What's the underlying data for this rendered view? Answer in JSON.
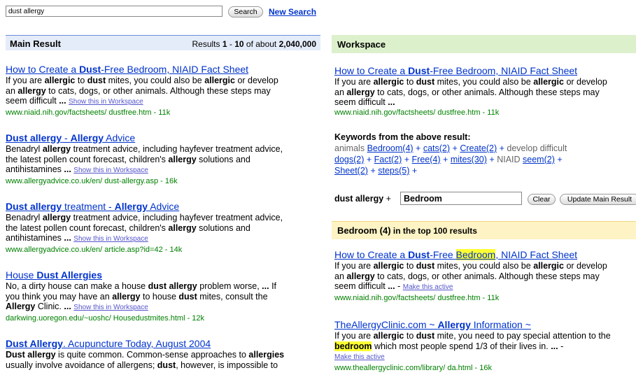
{
  "search": {
    "value": "dust allergy",
    "button": "Search",
    "new_search": "New Search"
  },
  "main": {
    "title": "Main Result",
    "count_prefix": "Results ",
    "count_from": "1",
    "count_sep": " - ",
    "count_to": "10",
    "count_mid": " of about ",
    "count_total": "2,040,000",
    "results": [
      {
        "title_a": "How to Create a ",
        "title_b": "Dust",
        "title_c": "-Free Bedroom, NIAID Fact Sheet",
        "snip1_a": "If you are ",
        "snip1_b": "allergic",
        "snip1_c": " to ",
        "snip1_d": "dust",
        "snip1_e": " mites, you could also be ",
        "snip1_f": "allergic",
        "snip1_g": " or develop",
        "snip2_a": "an ",
        "snip2_b": "allergy",
        "snip2_c": " to cats, dogs, or other animals. Although these steps may",
        "snip3_a": "seem difficult ",
        "snip3_b": "...",
        "show": "Show this in Workspace",
        "url": "www.niaid.nih.gov/factsheets/ dustfree.htm - 11k"
      },
      {
        "title_a": "Dust allergy",
        "title_b": " - ",
        "title_c": "Allergy",
        "title_d": " Advice",
        "snip1": "Benadryl ",
        "snip1_b": "allergy",
        "snip1_c": " treatment advice, including hayfever treatment advice,",
        "snip2": "the latest pollen count forecast, children's ",
        "snip2_b": "allergy",
        "snip2_c": " solutions and",
        "snip3": "antihistamines ",
        "snip3_b": "...",
        "show": "Show this in Workspace",
        "url": "www.allergyadvice.co.uk/en/ dust-allergy.asp - 16k"
      },
      {
        "title_a": "Dust allergy",
        "title_b": " treatment - ",
        "title_c": "Allergy",
        "title_d": " Advice",
        "snip1": "Benadryl ",
        "snip1_b": "allergy",
        "snip1_c": " treatment advice, including hayfever treatment advice,",
        "snip2": "the latest pollen count forecast, children's ",
        "snip2_b": "allergy",
        "snip2_c": " solutions and",
        "snip3": "antihistamines ",
        "snip3_b": "...",
        "show": "Show this in Workspace",
        "url": "www.allergyadvice.co.uk/en/ article.asp?id=42 - 14k"
      },
      {
        "title_a": "House ",
        "title_b": "Dust Allergies",
        "snip1_a": "No, a dirty house can make a house ",
        "snip1_b": "dust allergy",
        "snip1_c": " problem worse, ",
        "snip1_d": "...",
        "snip1_e": " If",
        "snip2_a": "you think you may have an ",
        "snip2_b": "allergy",
        "snip2_c": " to house ",
        "snip2_d": "dust",
        "snip2_e": " mites, consult the",
        "snip3_a": "Allergy",
        "snip3_b": " Clinic. ",
        "snip3_c": "...",
        "show": "Show this in Workspace",
        "url": "darkwing.uoregon.edu/~uoshc/ Housedustmites.html - 12k"
      },
      {
        "title_a": "Dust Allergy",
        "title_b": ". Acupuncture Today, August 2004",
        "snip1_a": "Dust allergy",
        "snip1_b": " is quite common. Common-sense approaches to ",
        "snip1_c": "allergies",
        "snip2_a": "usually involve avoidance of allergens; ",
        "snip2_b": "dust",
        "snip2_c": ", however, is impossible to"
      }
    ]
  },
  "workspace": {
    "title": "Workspace",
    "result": {
      "title_a": "How to Create a ",
      "title_b": "Dust",
      "title_c": "-Free Bedroom, NIAID Fact Sheet",
      "snip1_a": "If you are ",
      "snip1_b": "allergic",
      "snip1_c": " to ",
      "snip1_d": "dust",
      "snip1_e": " mites, you could also be ",
      "snip1_f": "allergic",
      "snip1_g": " or develop",
      "snip2_a": "an ",
      "snip2_b": "allergy",
      "snip2_c": " to cats, dogs, or other animals. Although these steps may",
      "snip3_a": "seem difficult ",
      "snip3_b": "...",
      "url": "www.niaid.nih.gov/factsheets/ dustfree.htm - 11k"
    },
    "keywords_title": "Keywords from the above result:",
    "keywords": {
      "animals": "animals",
      "bedroom": "Bedroom(4)",
      "cats": "cats(2)",
      "create": "Create(2)",
      "develop": "develop",
      "difficult": "difficult",
      "dogs": "dogs(2)",
      "fact": "Fact(2)",
      "free": "Free(4)",
      "mites": "mites(30)",
      "niaid": "NIAID",
      "seem": "seem(2)",
      "sheet": "Sheet(2)",
      "steps": "steps(5)",
      "plus": "+"
    },
    "refine": {
      "label_a": "dust allergy",
      "label_b": " + ",
      "value": "Bedroom",
      "clear": "Clear",
      "update": "Update Main Result"
    },
    "bedroom": {
      "title": "Bedroom (4)",
      "suffix": " in the top 100 results",
      "results": [
        {
          "title_a": "How to Create a ",
          "title_b": "Dust",
          "title_c": "-Free ",
          "title_hl": "Bedroom",
          "title_d": ", NIAID Fact Sheet",
          "snip1_a": "If you are ",
          "snip1_b": "allergic",
          "snip1_c": " to ",
          "snip1_d": "dust",
          "snip1_e": " mites, you could also be ",
          "snip1_f": "allergic",
          "snip1_g": " or develop",
          "snip2_a": "an ",
          "snip2_b": "allergy",
          "snip2_c": " to cats, dogs, or other animals. Although these steps may",
          "snip3_a": "seem difficult ",
          "snip3_b": "...",
          "snip3_c": " - ",
          "active": "Make this active",
          "url": "www.niaid.nih.gov/factsheets/ dustfree.htm - 11k"
        },
        {
          "title_a": "TheAllergyClinic.com ~ ",
          "title_b": "Allergy",
          "title_c": " Information ~",
          "snip1_a": "If you are ",
          "snip1_b": "allergic",
          "snip1_c": " to ",
          "snip1_d": "dust",
          "snip1_e": " mite, you need to pay special attention to the",
          "snip2_hl": "bedroom",
          "snip2_a": " which most people spend 1/3 of their lives in. ",
          "snip2_b": "...",
          "snip2_c": " -",
          "active": "Make this active",
          "url": "www.theallergyclinic.com/library/ da.html - 16k"
        }
      ]
    }
  }
}
